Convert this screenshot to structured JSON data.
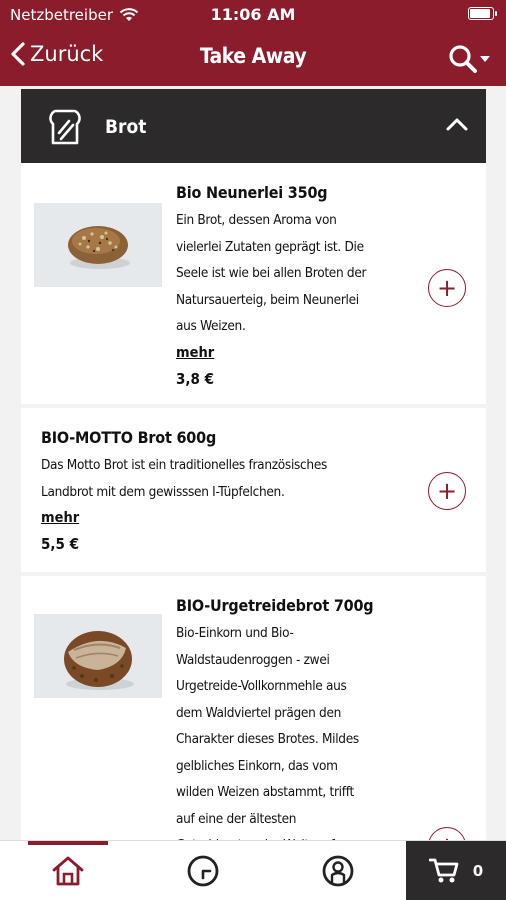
{
  "status": {
    "carrier": "Netzbetreiber",
    "time": "11:06 AM"
  },
  "nav": {
    "back_label": "Zurück",
    "title": "Take Away"
  },
  "section": {
    "title": "Brot"
  },
  "products": [
    {
      "name": "Bio Neunerlei 350g",
      "desc_lines": [
        "Ein Brot, dessen Aroma von",
        "vielerlei Zutaten geprägt ist. Die",
        "Seele ist wie bei allen Broten der",
        "Natursauerteig, beim Neunerlei",
        "aus Weizen."
      ],
      "more": "mehr",
      "price": "3,8 €"
    },
    {
      "name": "BIO-MOTTO Brot 600g",
      "desc_lines": [
        "Das Motto Brot ist ein traditionelles französisches",
        "Landbrot mit dem gewisssen I-Tüpfelchen."
      ],
      "more": "mehr",
      "price": "5,5 €"
    },
    {
      "name": "BIO-Urgetreidebrot 700g",
      "desc_lines": [
        "Bio-Einkorn und Bio-",
        "Waldstaudenroggen - zwei",
        "Urgetreide-Vollkornmehle aus",
        "dem Waldviertel prägen den",
        "Charakter dieses Brotes. Mildes",
        "gelbliches Einkorn, das vom",
        "wilden Weizen abstammt, trifft",
        "auf eine der ältesten",
        "Getreidearten der Welt, auf"
      ]
    }
  ],
  "add_symbol": "+",
  "cart": {
    "count": "0"
  },
  "colors": {
    "brand": "#8b1c2c",
    "dark": "#2c2a2b"
  }
}
